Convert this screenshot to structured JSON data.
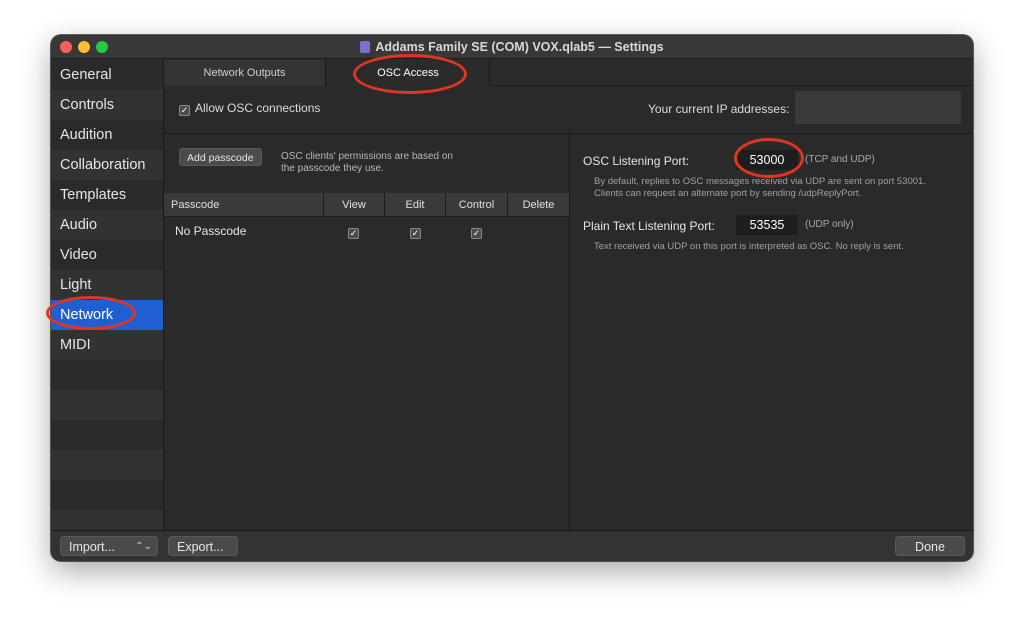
{
  "window": {
    "title": "Addams Family SE (COM) VOX.qlab5 — Settings"
  },
  "sidebar": {
    "items": [
      {
        "label": "General"
      },
      {
        "label": "Controls"
      },
      {
        "label": "Audition"
      },
      {
        "label": "Collaboration"
      },
      {
        "label": "Templates"
      },
      {
        "label": "Audio"
      },
      {
        "label": "Video"
      },
      {
        "label": "Light"
      },
      {
        "label": "Network",
        "selected": true
      },
      {
        "label": "MIDI"
      }
    ]
  },
  "tabs": [
    {
      "label": "Network Outputs"
    },
    {
      "label": "OSC Access",
      "selected": true
    }
  ],
  "osc": {
    "allow_label": "Allow OSC connections",
    "allow_checked": true,
    "ip_label": "Your current IP addresses:",
    "add_passcode_label": "Add passcode",
    "permissions_note": "OSC clients' permissions are based on the passcode they use.",
    "table": {
      "columns": [
        "Passcode",
        "View",
        "Edit",
        "Control",
        "Delete"
      ],
      "rows": [
        {
          "passcode": "No Passcode",
          "view": true,
          "edit": true,
          "control": true,
          "delete": false
        }
      ]
    },
    "listening_port_label": "OSC Listening Port:",
    "listening_port": "53000",
    "listening_port_note": "(TCP and UDP)",
    "listening_desc": "By default, replies to OSC messages received via UDP are sent on port 53001. Clients can request an alternate port by sending /udpReplyPort.",
    "plain_port_label": "Plain Text Listening Port:",
    "plain_port": "53535",
    "plain_port_note": "(UDP only)",
    "plain_desc": "Text received via UDP on this port is interpreted as OSC. No reply is sent."
  },
  "footer": {
    "import_label": "Import...",
    "export_label": "Export...",
    "done_label": "Done"
  },
  "colors": {
    "selection": "#1f5fd1",
    "annotation": "#e03524"
  }
}
